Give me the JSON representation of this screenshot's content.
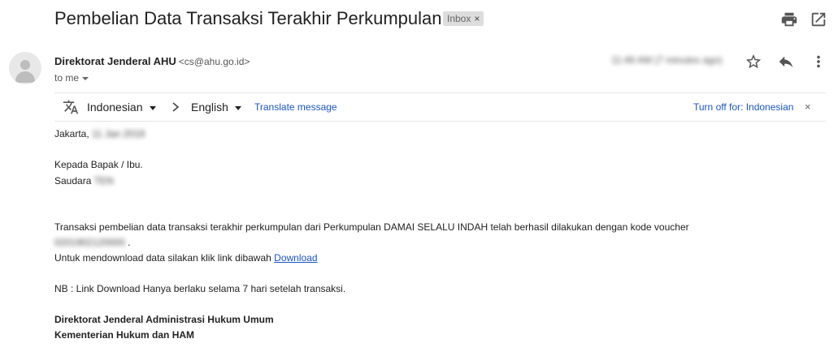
{
  "header": {
    "subject": "Pembelian Data Transaksi Terakhir Perkumpulan",
    "label": "Inbox",
    "label_remove": "×"
  },
  "icons": {
    "print": "print-icon",
    "open_new_window": "open-in-new-icon",
    "star": "star-icon",
    "reply": "reply-icon",
    "more": "more-vert-icon",
    "translate": "translate-icon",
    "avatar": "person-icon"
  },
  "sender": {
    "name": "Direktorat Jenderal AHU",
    "email": "<cs@ahu.go.id>",
    "to": "to me",
    "timestamp": "11:46 AM (7 minutes ago)"
  },
  "translate_bar": {
    "source_lang": "Indonesian",
    "target_lang": "English",
    "translate_link": "Translate message",
    "turn_off": "Turn off for: Indonesian",
    "close": "×"
  },
  "body": {
    "city_prefix": "Jakarta,",
    "date": "11 Jan 2019",
    "greeting": "Kepada Bapak / Ibu.",
    "saudara_prefix": "Saudara",
    "saudara_name": "TEN",
    "paragraph1": "Transaksi pembelian data transaksi terakhir perkumpulan dari Perkumpulan DAMAI SELALU INDAH telah berhasil dilakukan dengan kode voucher",
    "voucher_code": "0201902120000",
    "voucher_suffix": ".",
    "download_text": "Untuk mendownload data silakan klik link dibawah",
    "download_link": "Download",
    "note": "NB : Link Download Hanya berlaku selama 7 hari setelah transaksi.",
    "signature_line1": "Direktorat Jenderal Administrasi Hukum Umum",
    "signature_line2": "Kementerian Hukum dan HAM"
  }
}
